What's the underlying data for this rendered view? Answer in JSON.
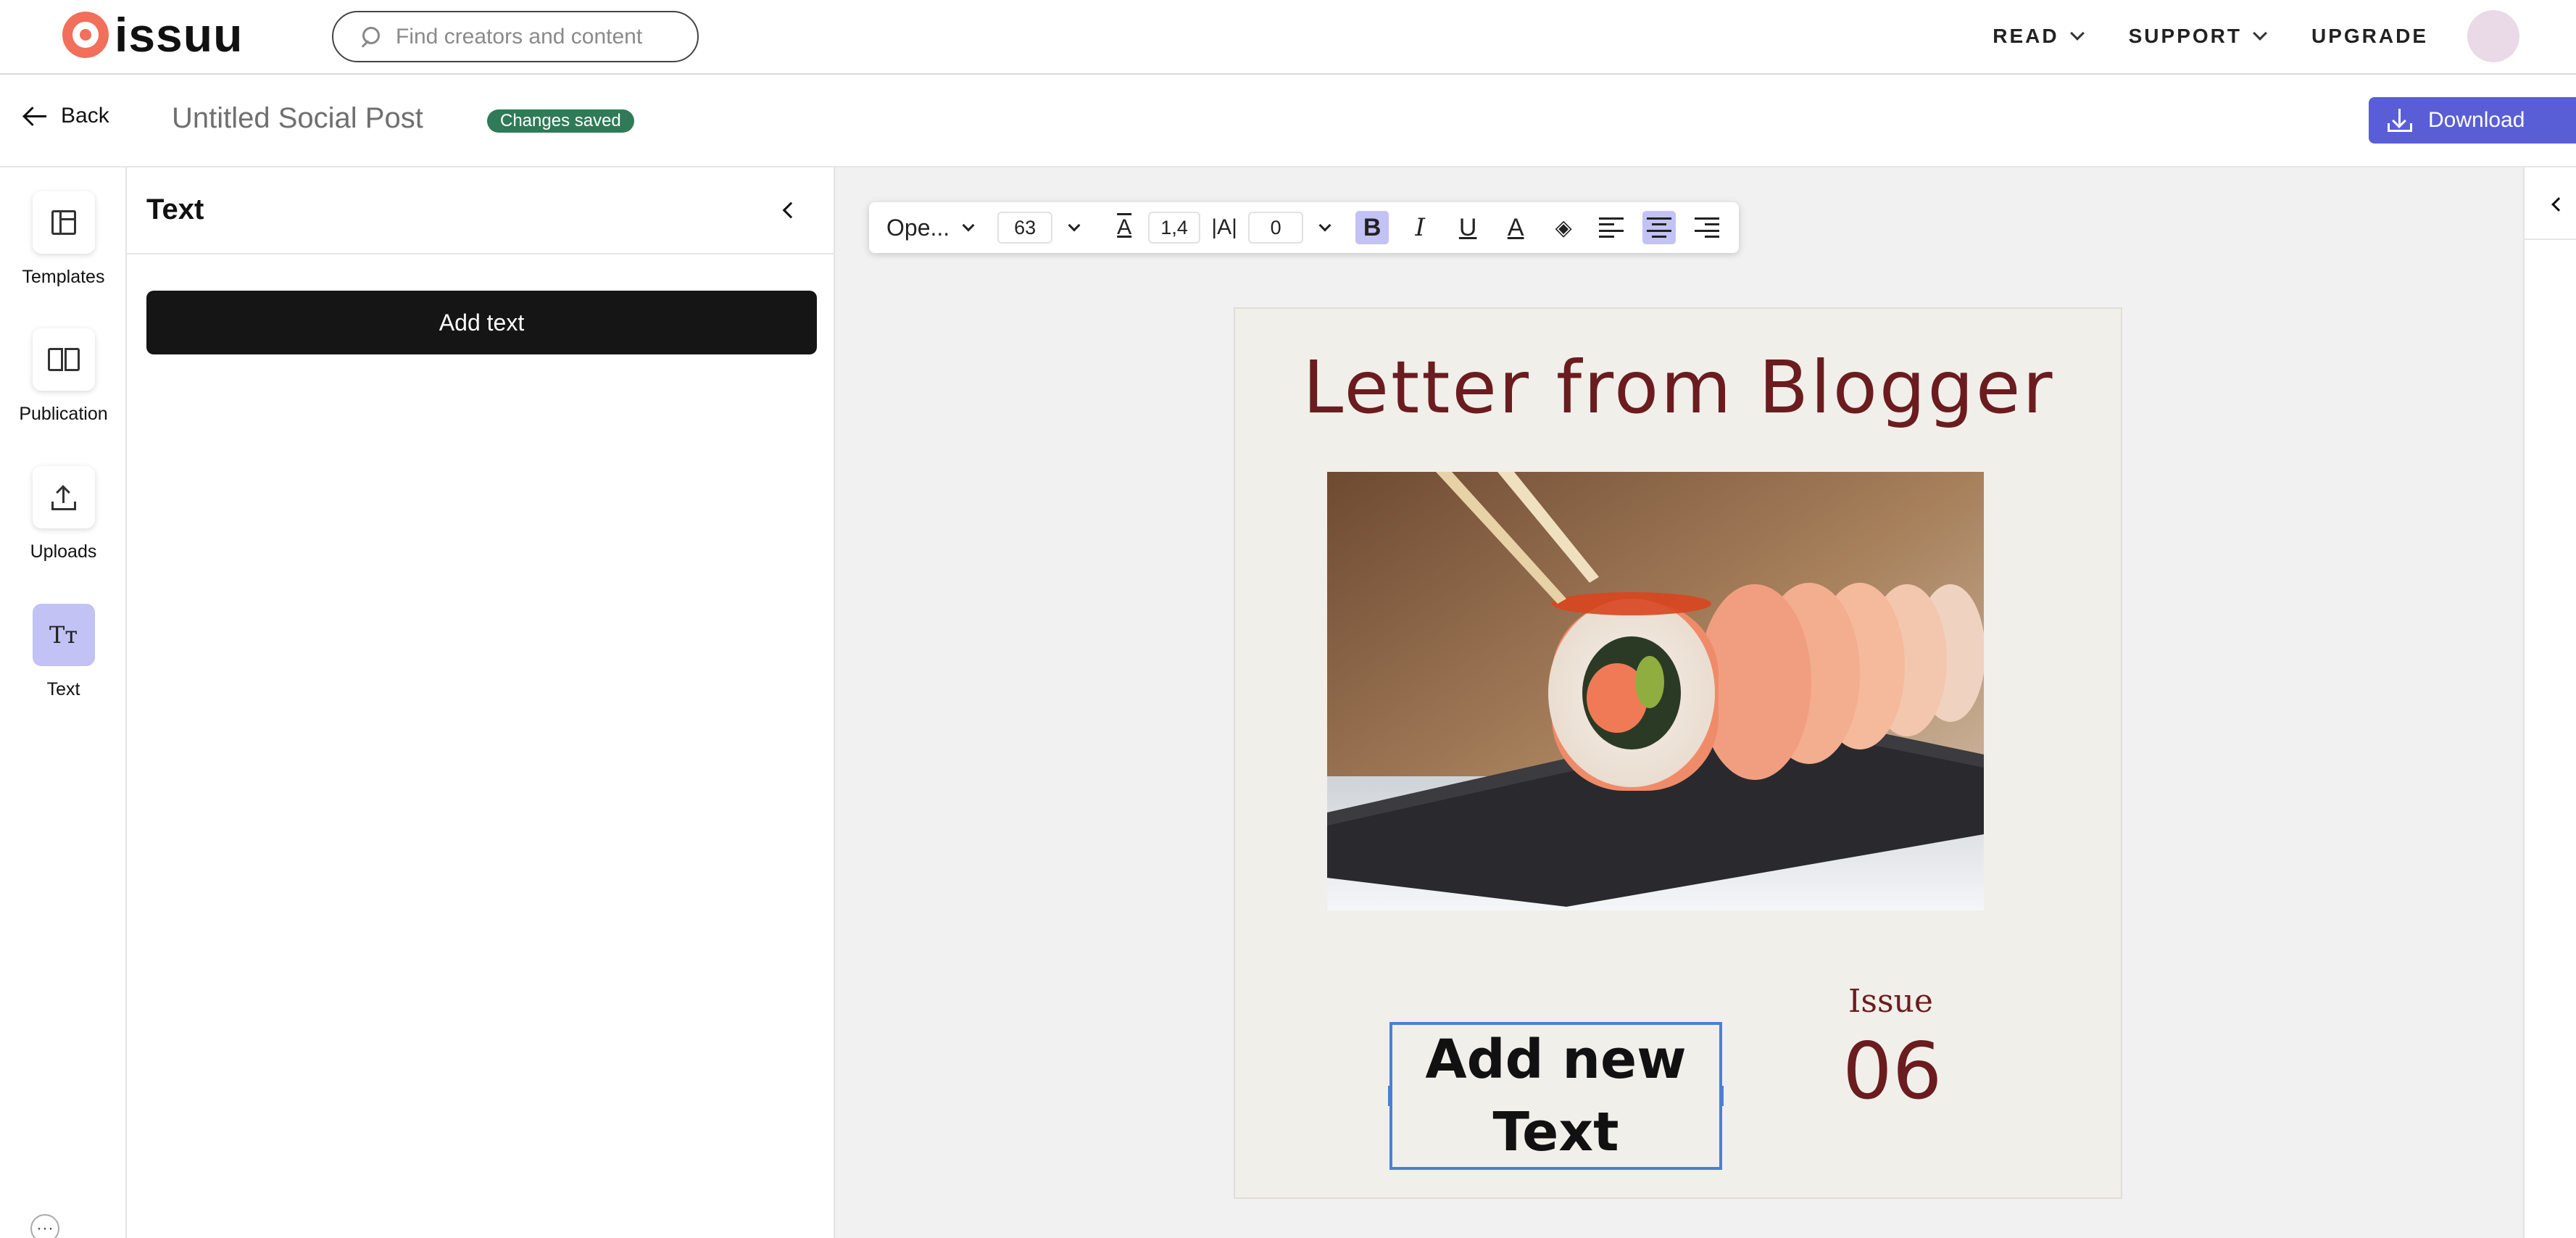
{
  "nav": {
    "logo_text": "issuu",
    "search_placeholder": "Find creators and content",
    "links": [
      {
        "label": "READ",
        "has_dropdown": true
      },
      {
        "label": "SUPPORT",
        "has_dropdown": true
      },
      {
        "label": "UPGRADE",
        "has_dropdown": false
      }
    ]
  },
  "header": {
    "back_label": "Back",
    "doc_title": "Untitled Social Post",
    "saved_badge": "Changes saved",
    "download_label": "Download"
  },
  "rail": {
    "items": [
      {
        "label": "Templates",
        "icon": "templates-icon",
        "active": false
      },
      {
        "label": "Publication",
        "icon": "book-icon",
        "active": false
      },
      {
        "label": "Uploads",
        "icon": "upload-icon",
        "active": false
      },
      {
        "label": "Text",
        "icon": "text-icon",
        "icon_glyph": "Tт",
        "active": true
      }
    ]
  },
  "panel": {
    "title": "Text",
    "add_text_label": "Add text"
  },
  "toolbar": {
    "font_name": "Ope...",
    "font_size": "63",
    "line_height": "1,4",
    "letter_spacing": "0",
    "bold": true,
    "align": "center"
  },
  "page": {
    "headline": "Letter from Blogger",
    "issue_label": "Issue",
    "issue_number": "06",
    "selected_text_line1": "Add new",
    "selected_text_line2": "Text",
    "photo_subject": "sushi roll with chopsticks"
  },
  "colors": {
    "accent": "#5a5ed6",
    "saved_badge": "#2f7a57",
    "headline": "#6b1c1f",
    "selection": "#4a7fd6",
    "active_tool": "#c2c2f5",
    "page_bg": "#f1efea"
  }
}
